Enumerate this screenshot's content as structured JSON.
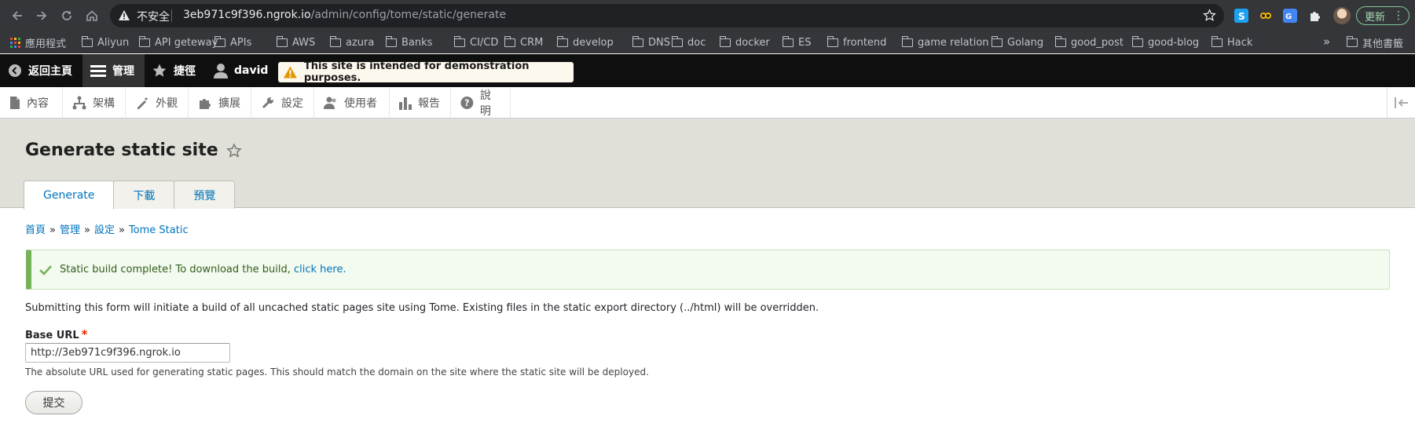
{
  "browser": {
    "security_label": "不安全",
    "url_host": "3eb971c9f396.ngrok.io",
    "url_path": "/admin/config/tome/static/generate",
    "update_label": "更新",
    "bookmarks": [
      {
        "label": "應用程式",
        "icon": "apps-icon"
      },
      {
        "label": "Aliyun",
        "icon": "folder-icon"
      },
      {
        "label": "API geteway",
        "icon": "folder-icon"
      },
      {
        "label": "APIs",
        "icon": "folder-icon"
      },
      {
        "label": "AWS",
        "icon": "folder-icon"
      },
      {
        "label": "azura",
        "icon": "folder-icon"
      },
      {
        "label": "Banks",
        "icon": "folder-icon"
      },
      {
        "label": "CI/CD",
        "icon": "folder-icon"
      },
      {
        "label": "CRM",
        "icon": "folder-icon"
      },
      {
        "label": "develop",
        "icon": "folder-icon"
      },
      {
        "label": "DNS",
        "icon": "folder-icon"
      },
      {
        "label": "doc",
        "icon": "folder-icon"
      },
      {
        "label": "docker",
        "icon": "folder-icon"
      },
      {
        "label": "ES",
        "icon": "folder-icon"
      },
      {
        "label": "frontend",
        "icon": "folder-icon"
      },
      {
        "label": "game relation",
        "icon": "folder-icon"
      },
      {
        "label": "Golang",
        "icon": "folder-icon"
      },
      {
        "label": "good_post",
        "icon": "folder-icon"
      },
      {
        "label": "good-blog",
        "icon": "folder-icon"
      },
      {
        "label": "Hack",
        "icon": "folder-icon"
      }
    ],
    "bookmarks_more": "»",
    "other_bookmarks": "其他書籤"
  },
  "toolbar": {
    "back_home": "返回主頁",
    "manage": "管理",
    "shortcuts": "捷徑",
    "user": "david",
    "demo_notice": "This site is intended for demonstration purposes."
  },
  "tray": {
    "items": [
      "內容",
      "架構",
      "外觀",
      "擴展",
      "設定",
      "使用者",
      "報告",
      "說明"
    ]
  },
  "page": {
    "title": "Generate static site",
    "tabs": [
      "Generate",
      "下載",
      "預覽"
    ]
  },
  "breadcrumb": [
    "首頁",
    "管理",
    "設定",
    "Tome Static"
  ],
  "breadcrumb_sep": "»",
  "status": {
    "text": "Static build complete! To download the build,",
    "link": "click here."
  },
  "form": {
    "description": "Submitting this form will initiate a build of all uncached static pages site using Tome. Existing files in the static export directory (../html) will be overridden.",
    "base_url_label": "Base URL",
    "required_mark": "*",
    "base_url_value": "http://3eb971c9f396.ngrok.io",
    "base_url_help": "The absolute URL used for generating static pages. This should match the domain on the site where the static site will be deployed.",
    "submit_label": "提交"
  },
  "colors": {
    "link": "#0074bd",
    "status_border": "#77b259",
    "status_bg": "#f3faef",
    "toolbar_bg": "#0f0f0f",
    "header_bg": "#e0e0d8",
    "required": "#e62600"
  }
}
